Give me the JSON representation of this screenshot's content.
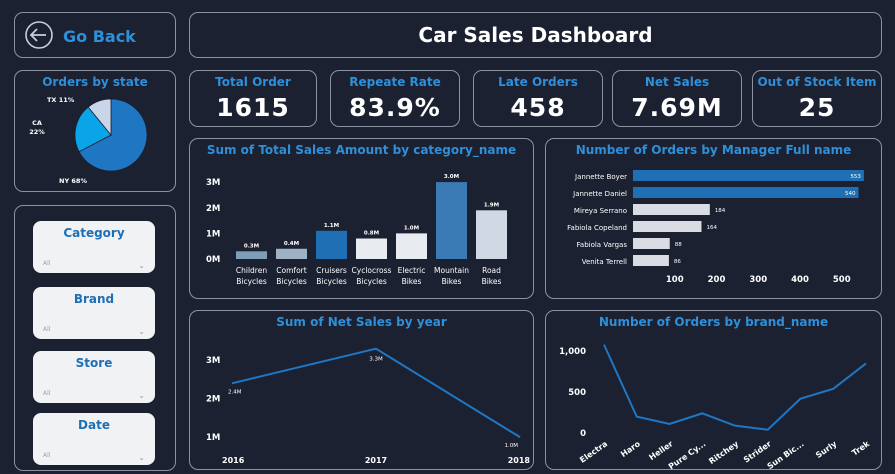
{
  "nav": {
    "back_label": "Go Back"
  },
  "header": {
    "title": "Car Sales Dashboard"
  },
  "kpis": [
    {
      "label": "Total Order",
      "value": "1615"
    },
    {
      "label": "Repeate Rate",
      "value": "83.9%"
    },
    {
      "label": "Late Orders",
      "value": "458"
    },
    {
      "label": "Net Sales",
      "value": "7.69M"
    },
    {
      "label": "Out of Stock Item",
      "value": "25"
    }
  ],
  "filters": [
    {
      "label": "Category",
      "value": "All"
    },
    {
      "label": "Brand",
      "value": "All"
    },
    {
      "label": "Store",
      "value": "All"
    },
    {
      "label": "Date",
      "value": "All"
    }
  ],
  "colors": {
    "accent": "#2f8fd8",
    "background": "#1b2130",
    "border": "#8b93a3"
  },
  "chart_data": [
    {
      "type": "pie",
      "title": "Orders by state",
      "categories": [
        "NY",
        "CA",
        "TX"
      ],
      "values": [
        68,
        22,
        11
      ],
      "value_labels": [
        "NY 68%",
        "CA 22%",
        "TX 11%"
      ],
      "colors": [
        "#1f77c4",
        "#0aa5e8",
        "#c9d6ea"
      ]
    },
    {
      "type": "bar",
      "title": "Sum of Total Sales Amount by category_name",
      "categories": [
        "Children Bicycles",
        "Comfort Bicycles",
        "Cruisers Bicycles",
        "Cyclocross Bicycles",
        "Electric Bikes",
        "Mountain Bikes",
        "Road Bikes"
      ],
      "values": [
        0.3,
        0.4,
        1.1,
        0.8,
        1.0,
        3.0,
        1.9
      ],
      "value_labels": [
        "0.3M",
        "0.4M",
        "1.1M",
        "0.8M",
        "1.0M",
        "3.0M",
        "1.9M"
      ],
      "ytick_labels": [
        "0M",
        "1M",
        "2M",
        "3M"
      ],
      "ylim": [
        0,
        3.2
      ],
      "colors": [
        "#7f9db9",
        "#9fb2c5",
        "#1f6fb5",
        "#e8ecf1",
        "#e8ecf1",
        "#3a7bb5",
        "#d0d9e3"
      ]
    },
    {
      "type": "bar",
      "orientation": "horizontal",
      "title": "Number of Orders by Manager Full name",
      "categories": [
        "Jannette Boyer",
        "Jannette Daniel",
        "Mireya Serrano",
        "Fabiola Copeland",
        "Fabiola Vargas",
        "Venita Terrell"
      ],
      "values": [
        553,
        540,
        184,
        164,
        88,
        86
      ],
      "xtick_labels": [
        "100",
        "200",
        "300",
        "400",
        "500"
      ],
      "xlim": [
        0,
        570
      ],
      "colors": [
        "#1f6fb5",
        "#1f6fb5",
        "#d9dde3",
        "#d9dde3",
        "#d9dde3",
        "#d9dde3"
      ]
    },
    {
      "type": "line",
      "title": "Sum of Net Sales by year",
      "x": [
        "2016",
        "2017",
        "2018"
      ],
      "values": [
        2.4,
        3.3,
        1.0
      ],
      "value_labels": [
        "2.4M",
        "3.3M",
        "1.0M"
      ],
      "ytick_labels": [
        "1M",
        "2M",
        "3M"
      ],
      "ylim": [
        0.9,
        3.5
      ],
      "color": "#1f77c4"
    },
    {
      "type": "line",
      "title": "Number of Orders by brand_name",
      "x": [
        "Electra",
        "Haro",
        "Heller",
        "Pure Cy...",
        "Ritchey",
        "Strider",
        "Sun Bic...",
        "Surly",
        "Trek"
      ],
      "values": [
        1080,
        200,
        110,
        240,
        90,
        40,
        420,
        540,
        850
      ],
      "ytick_labels": [
        "0",
        "500",
        "1,000"
      ],
      "ylim": [
        0,
        1100
      ],
      "color": "#1f77c4"
    }
  ]
}
